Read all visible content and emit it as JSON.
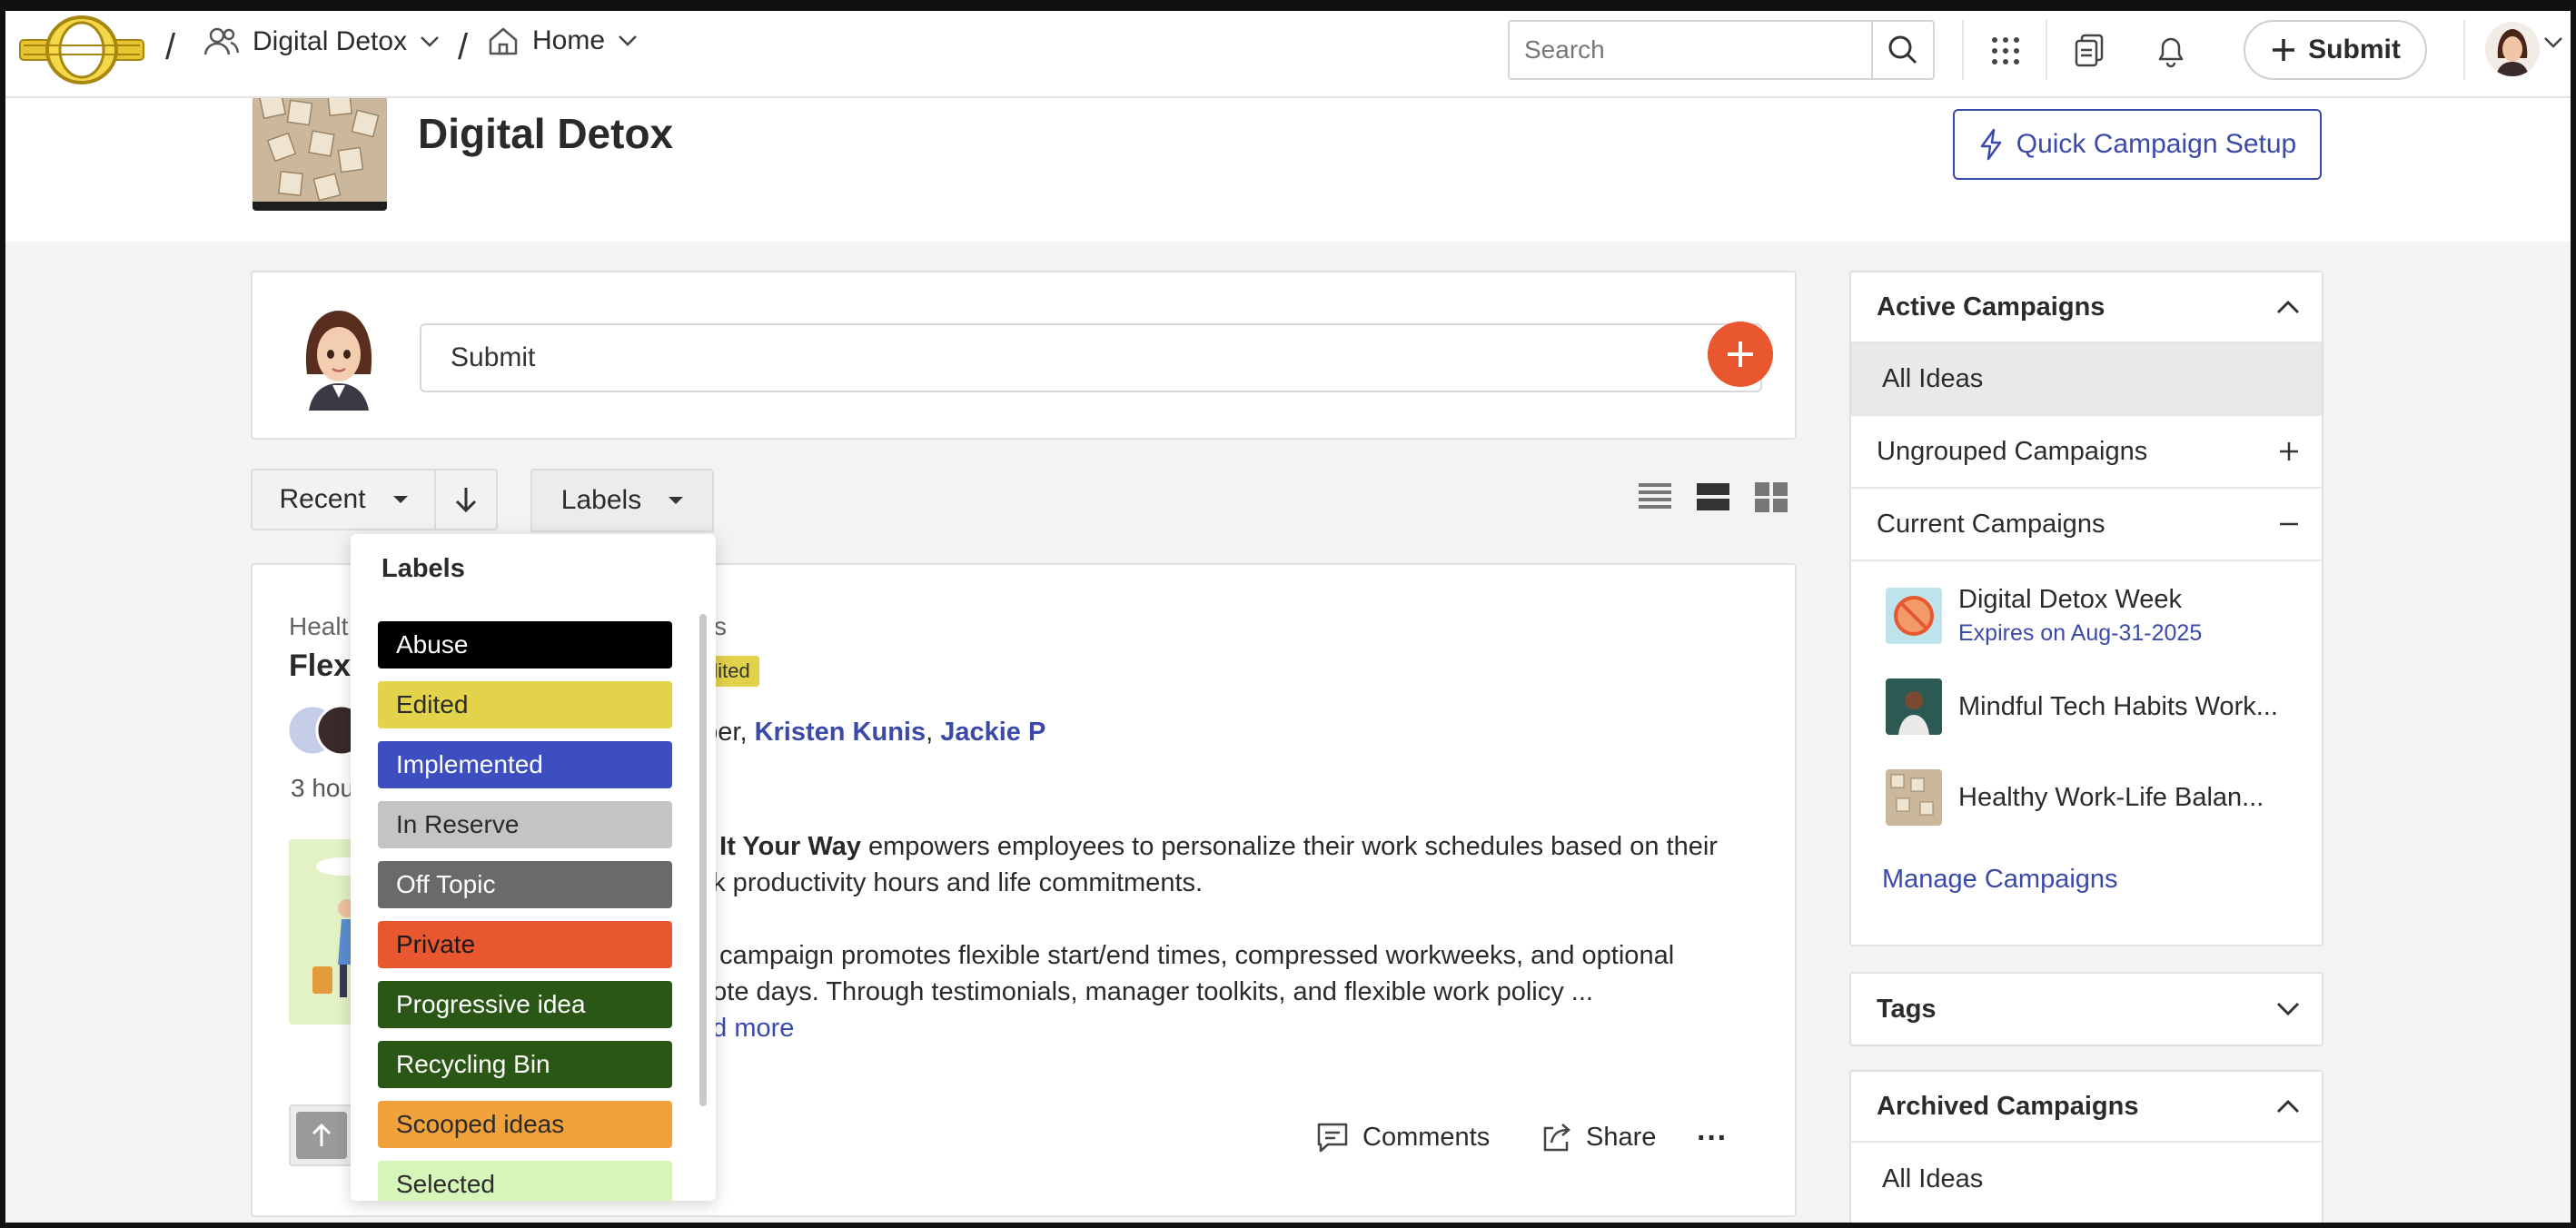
{
  "breadcrumb": {
    "sep1": "/",
    "community": "Digital Detox",
    "sep2": "/",
    "page": "Home"
  },
  "search": {
    "placeholder": "Search"
  },
  "topbar": {
    "submit_label": "Submit"
  },
  "campaign": {
    "title": "Digital Detox",
    "quick_setup_label": "Quick Campaign Setup"
  },
  "submit_box": {
    "placeholder": "Submit"
  },
  "filters": {
    "sort_label": "Recent",
    "labels_button": "Labels"
  },
  "labels_menu": {
    "title": "Labels",
    "items": [
      {
        "label": "Abuse",
        "bg": "#000000",
        "fg": "#ffffff"
      },
      {
        "label": "Edited",
        "bg": "#e3d34b",
        "fg": "#2b2b2b"
      },
      {
        "label": "Implemented",
        "bg": "#3c4ec0",
        "fg": "#ffffff"
      },
      {
        "label": "In Reserve",
        "bg": "#c4c4c4",
        "fg": "#2b2b2b"
      },
      {
        "label": "Off Topic",
        "bg": "#6a6a6a",
        "fg": "#ffffff"
      },
      {
        "label": "Private",
        "bg": "#e8572f",
        "fg": "#1a1a1a"
      },
      {
        "label": "Progressive idea",
        "bg": "#2a5716",
        "fg": "#ffffff"
      },
      {
        "label": "Recycling Bin",
        "bg": "#2a5716",
        "fg": "#ffffff"
      },
      {
        "label": "Scooped ideas",
        "bg": "#f2a23a",
        "fg": "#2b2b2b"
      },
      {
        "label": "Selected",
        "bg": "#d6f5b8",
        "fg": "#2b2b2b"
      }
    ]
  },
  "idea": {
    "category_start": "Healt",
    "category_end": "s",
    "title_start": "Flex",
    "badge": "dited",
    "authors_prefix": "nber, ",
    "author1": "Kristen Kunis",
    "author_sep": ", ",
    "author2": "Jackie P",
    "time": "3 hou",
    "para1_bold": "x It Your Way",
    "para1_rest": " empowers employees to personalize their work schedules based on their",
    "para1_line2": "ak productivity hours and life commitments.",
    "para2_line1": "e campaign promotes flexible start/end times, compressed workweeks, and optional",
    "para2_line2": "note days. Through testimonials, manager toolkits, and flexible work policy ...",
    "read_more": "ad more",
    "comments_label": "Comments",
    "share_label": "Share",
    "more_label": "···"
  },
  "sidebar": {
    "active_title": "Active Campaigns",
    "all_ideas": "All Ideas",
    "ungrouped": "Ungrouped Campaigns",
    "current": "Current Campaigns",
    "campaigns": [
      {
        "name": "Digital Detox Week",
        "expires": "Expires on Aug-31-2025"
      },
      {
        "name": "Mindful Tech Habits Work...",
        "expires": ""
      },
      {
        "name": "Healthy Work-Life Balan...",
        "expires": ""
      }
    ],
    "manage": "Manage Campaigns",
    "tags": "Tags",
    "archived_title": "Archived Campaigns",
    "archived_all": "All Ideas"
  },
  "colors": {
    "accent_blue": "#3b4aa8",
    "accent_orange": "#e8572f"
  }
}
